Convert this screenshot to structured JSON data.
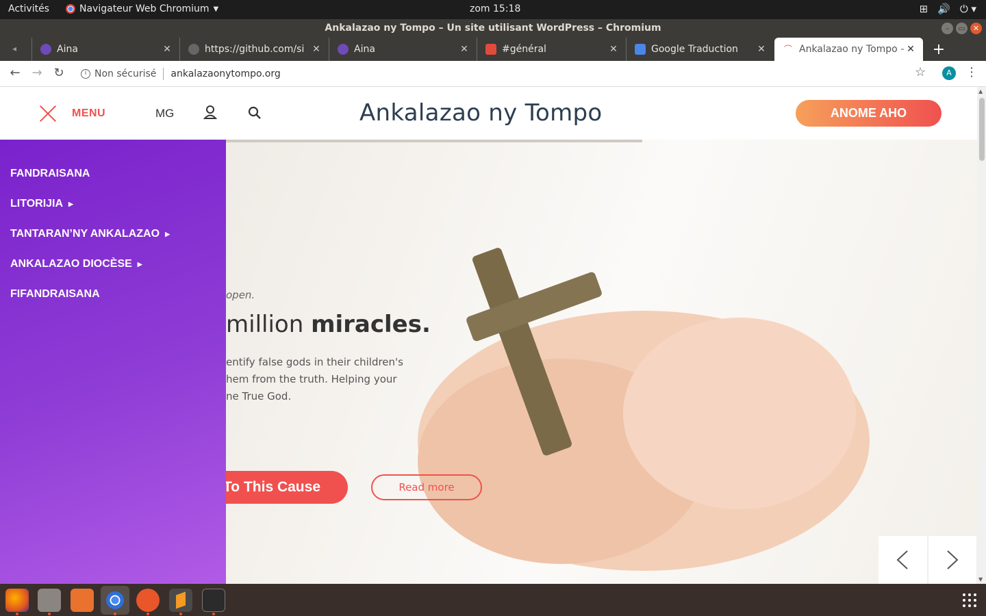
{
  "topbar": {
    "activities": "Activités",
    "app_menu": "Navigateur Web Chromium",
    "clock": "zom 15:18"
  },
  "window": {
    "title": "Ankalazao ny Tompo – Un site utilisant WordPress – Chromium"
  },
  "tabs": [
    {
      "label": "Aina"
    },
    {
      "label": "https://github.com/si"
    },
    {
      "label": "Aina"
    },
    {
      "label": "#général"
    },
    {
      "label": "Google Traduction"
    },
    {
      "label": "Ankalazao ny Tompo –"
    }
  ],
  "omnibox": {
    "security_label": "Non sécurisé",
    "url": "ankalazaonytompo.org",
    "profile_initial": "A"
  },
  "site": {
    "menu_label": "MENU",
    "language": "MG",
    "title": "Ankalazao ny Tompo",
    "cta": "ANOME AHO"
  },
  "side_menu": [
    {
      "label": "FANDRAISANA",
      "has_submenu": false
    },
    {
      "label": "LITORIJIA",
      "has_submenu": true
    },
    {
      "label": "TANTARAN’NY ANKALAZAO",
      "has_submenu": true
    },
    {
      "label": "ANKALAZAO DIOCÈSE",
      "has_submenu": true
    },
    {
      "label": "FIFANDRAISANA",
      "has_submenu": false
    }
  ],
  "hero": {
    "kicker": "open.",
    "headline_light": "million ",
    "headline_bold": "miracles.",
    "desc_1": "entify false gods in their children's",
    "desc_2": "hem from the truth. Helping your",
    "desc_3": "ne True God.",
    "primary_button": "To This Cause",
    "secondary_button": "Read more"
  },
  "colors": {
    "accent": "#f0514f",
    "menu_gradient_start": "#7a22cc",
    "menu_gradient_end": "#b15be6"
  }
}
